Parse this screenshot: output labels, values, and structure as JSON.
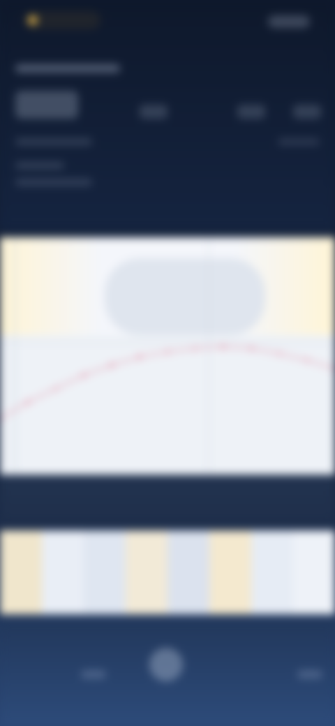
{
  "colors": {
    "header_bg": "#0e182b",
    "panel_bg": "#eef2f7",
    "line": "#e04f72",
    "nav_bg": "#2d4b7a"
  },
  "icons": {
    "logo": "logo-icon",
    "menu": "menu-icon",
    "nav_left": "nav-left-icon",
    "nav_center": "nav-center-icon",
    "nav_right": "nav-right-icon"
  },
  "chart_data": {
    "type": "line",
    "x": [
      0,
      1,
      2,
      3,
      4,
      5,
      6,
      7,
      8,
      9,
      10,
      11,
      12
    ],
    "series": [
      {
        "values": [
          0.0,
          0.1,
          0.18,
          0.26,
          0.32,
          0.37,
          0.4,
          0.42,
          0.43,
          0.42,
          0.39,
          0.35,
          0.3
        ],
        "color": "#e04f72"
      }
    ],
    "ylim": [
      0,
      1
    ],
    "grid": false
  }
}
